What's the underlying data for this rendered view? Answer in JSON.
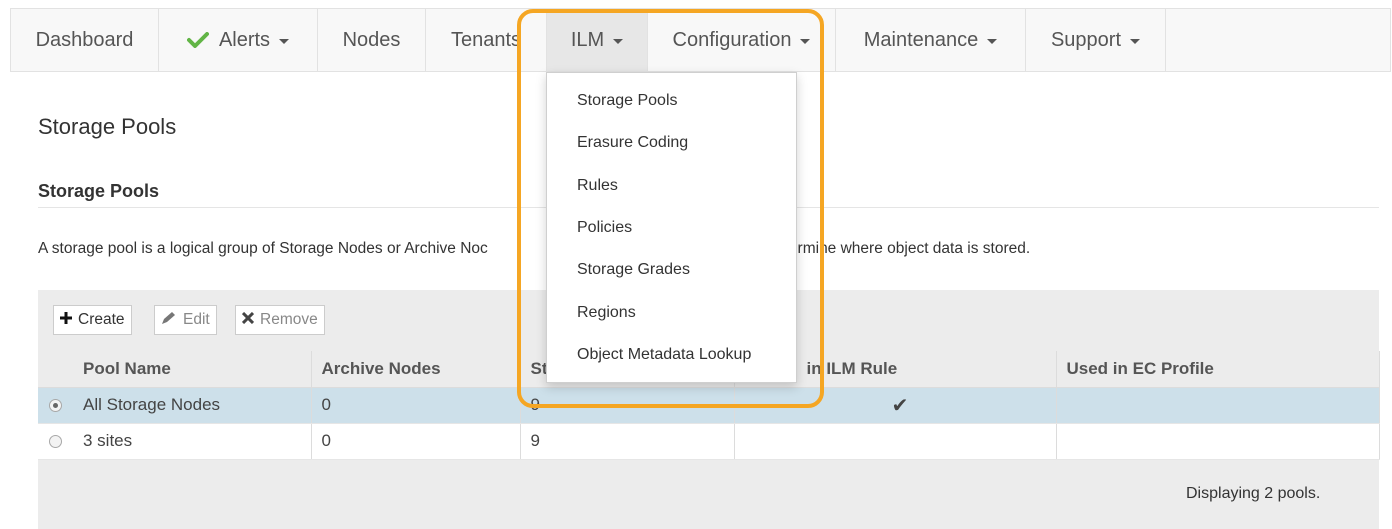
{
  "nav": {
    "items": [
      {
        "label": "Dashboard"
      },
      {
        "label": "Alerts",
        "dropdown": true,
        "icon": "check-icon",
        "icon_color": "#62b546"
      },
      {
        "label": "Nodes"
      },
      {
        "label": "Tenants"
      },
      {
        "label": "ILM",
        "dropdown": true,
        "active": true
      },
      {
        "label": "Configuration",
        "dropdown": true
      },
      {
        "label": "Maintenance",
        "dropdown": true
      },
      {
        "label": "Support",
        "dropdown": true
      }
    ]
  },
  "ilm_menu": {
    "items": [
      {
        "label": "Storage Pools"
      },
      {
        "label": "Erasure Coding"
      },
      {
        "label": "Rules"
      },
      {
        "label": "Policies"
      },
      {
        "label": "Storage Grades"
      },
      {
        "label": "Regions"
      },
      {
        "label": "Object Metadata Lookup"
      }
    ]
  },
  "page": {
    "title": "Storage Pools",
    "section_heading": "Storage Pools",
    "description_left": "A storage pool is a logical group of Storage Nodes or Archive Noc",
    "description_right": "etermine where object data is stored."
  },
  "toolbar": {
    "create_label": "Create",
    "edit_label": "Edit",
    "remove_label": "Remove"
  },
  "table": {
    "columns": [
      "Pool Name",
      "Archive Nodes",
      "St",
      "in ILM Rule",
      "Used in EC Profile"
    ],
    "rows": [
      {
        "selected": true,
        "pool_name": "All Storage Nodes",
        "archive_nodes": "0",
        "storage_nodes": "9",
        "used_in_ilm_rule": true,
        "used_in_ec_profile": ""
      },
      {
        "selected": false,
        "pool_name": "3 sites",
        "archive_nodes": "0",
        "storage_nodes": "9",
        "used_in_ilm_rule": false,
        "used_in_ec_profile": ""
      }
    ],
    "check_glyph": "✔"
  },
  "footer": {
    "text": "Displaying 2 pools."
  },
  "colors": {
    "highlight": "#f5a623",
    "selected_row": "#cde0ea",
    "check_green": "#62b546"
  }
}
